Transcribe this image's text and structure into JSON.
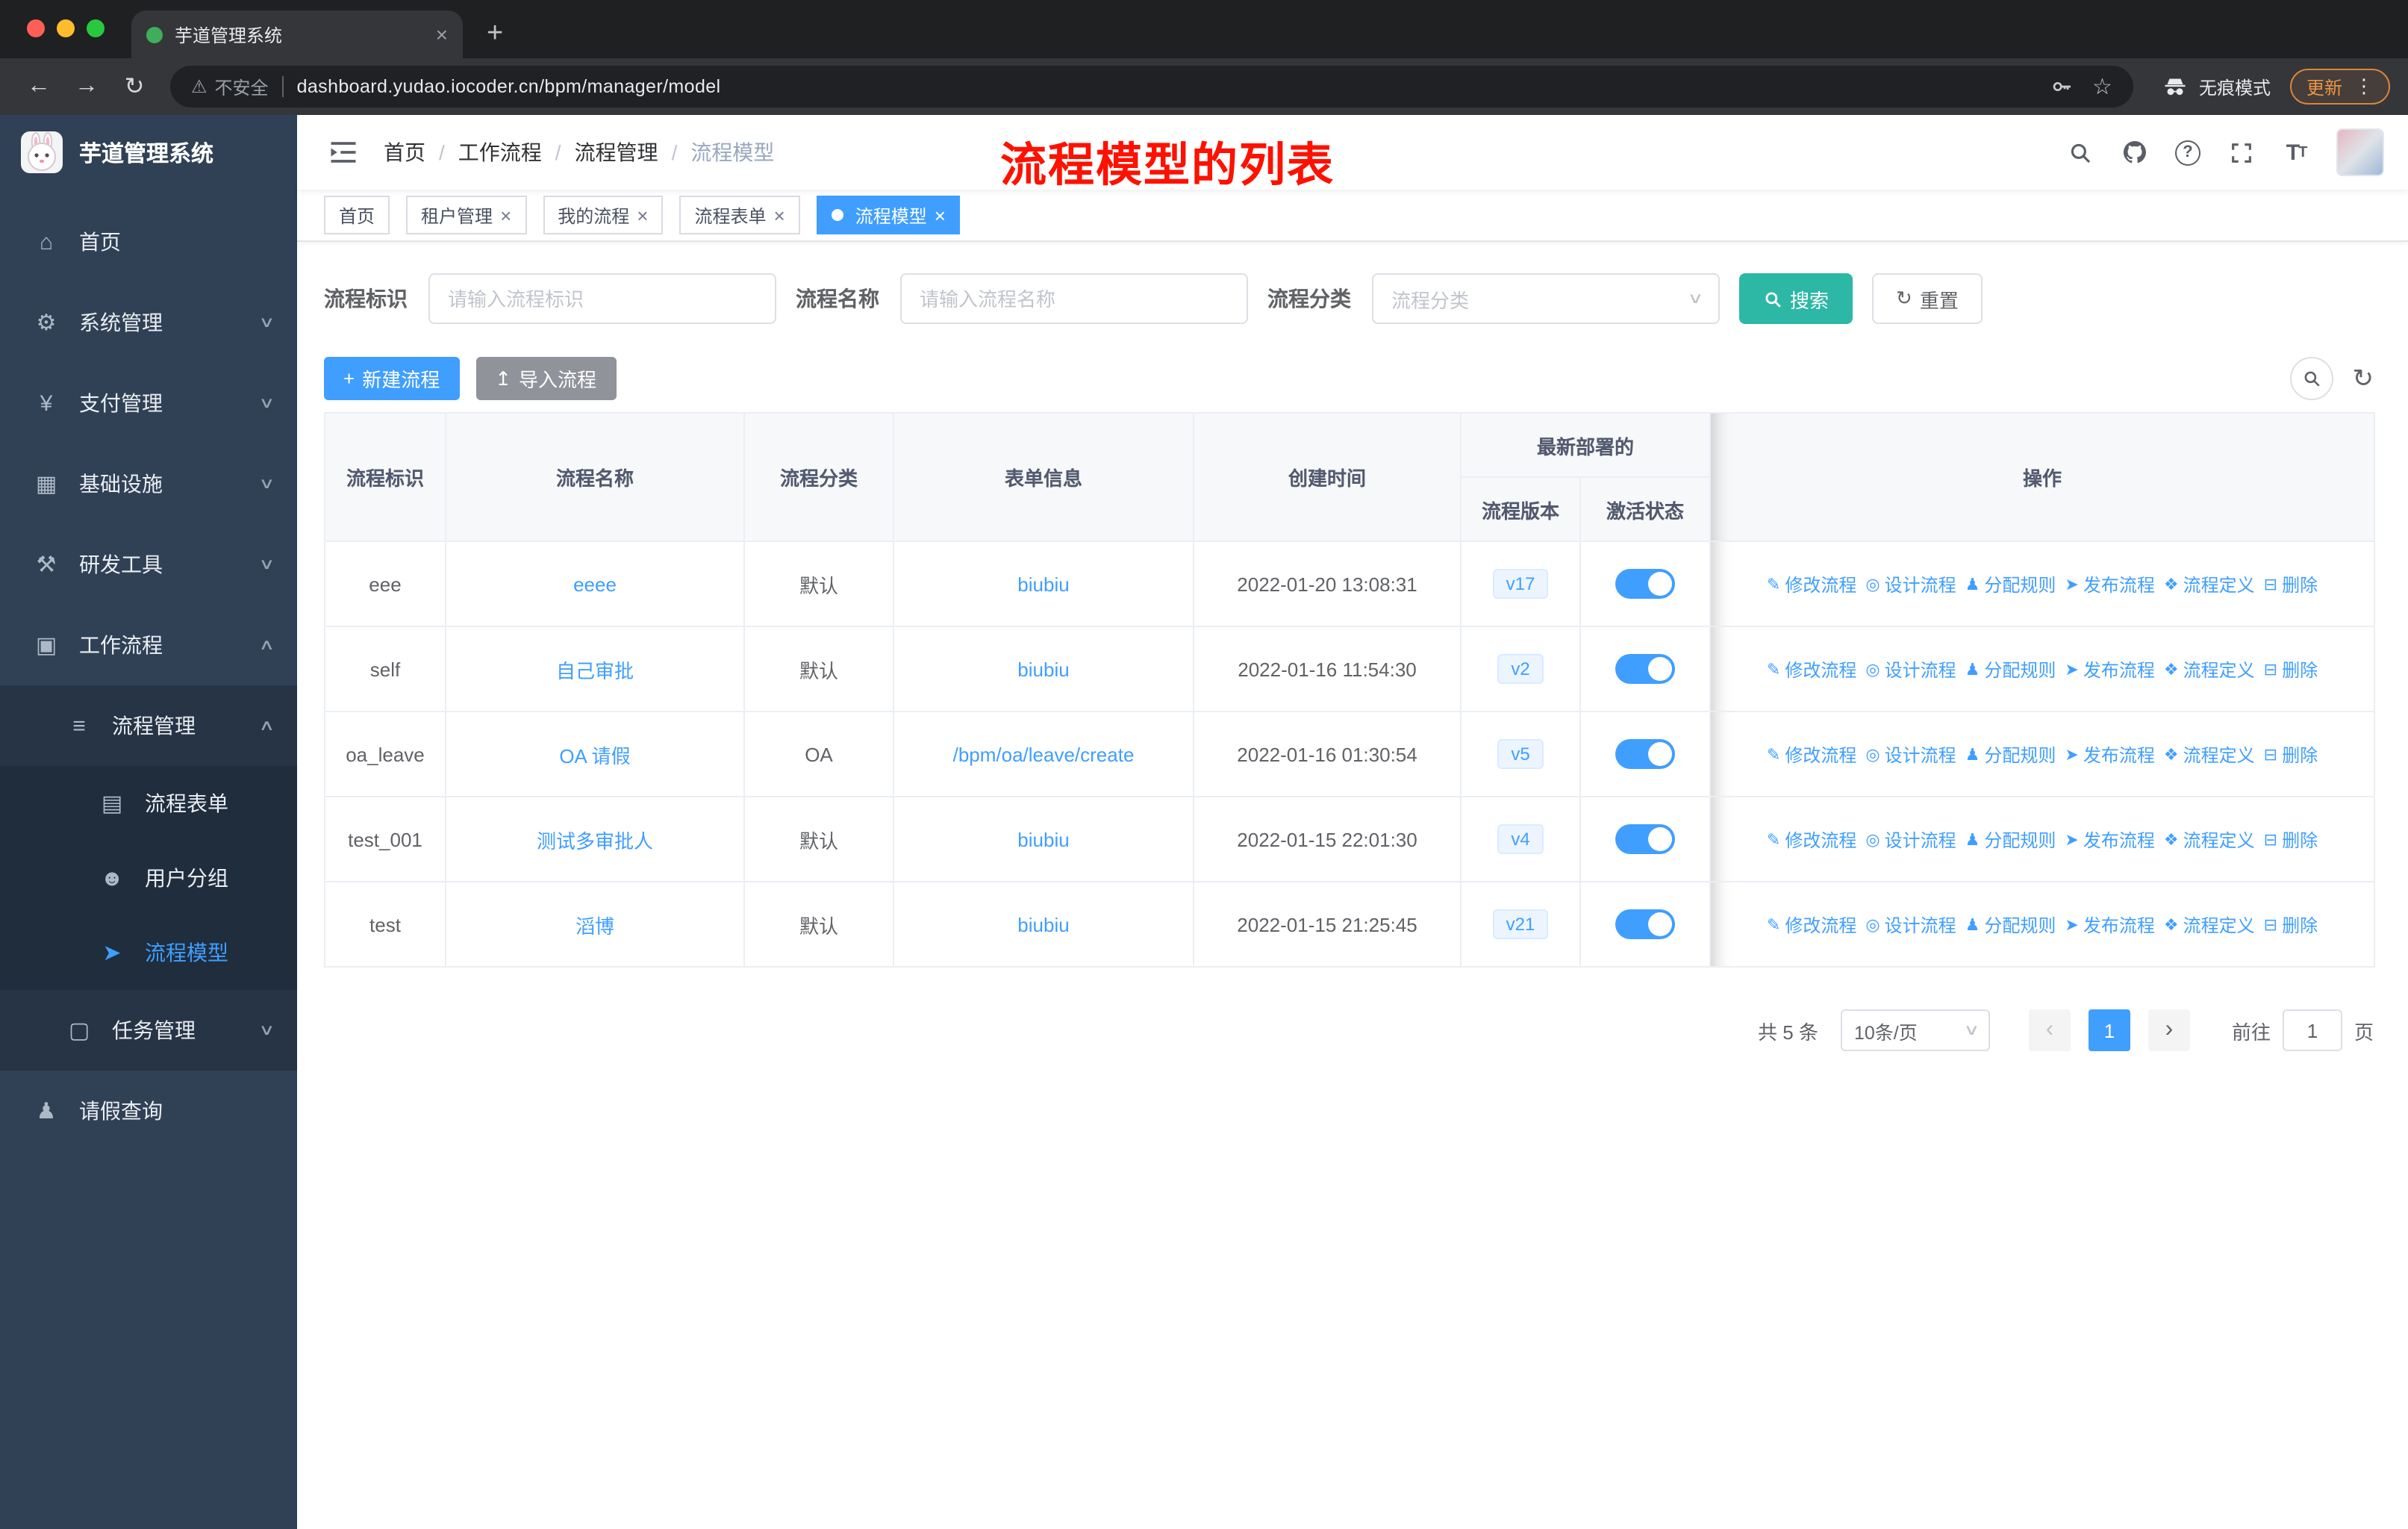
{
  "browser": {
    "tab": {
      "title": "芋道管理系统"
    },
    "address": {
      "security_label": "不安全",
      "url": "dashboard.yudao.iocoder.cn/bpm/manager/model"
    },
    "incognito_label": "无痕模式",
    "update_label": "更新"
  },
  "sidebar": {
    "logo_title": "芋道管理系统",
    "menu": [
      {
        "label": "首页",
        "icon": "home-icon",
        "level": 0,
        "arrow": null,
        "active": false
      },
      {
        "label": "系统管理",
        "icon": "gear-icon",
        "level": 0,
        "arrow": "down",
        "active": false
      },
      {
        "label": "支付管理",
        "icon": "yen-icon",
        "level": 0,
        "arrow": "down",
        "active": false
      },
      {
        "label": "基础设施",
        "icon": "infrastructure-icon",
        "level": 0,
        "arrow": "down",
        "active": false
      },
      {
        "label": "研发工具",
        "icon": "tools-icon",
        "level": 0,
        "arrow": "down",
        "active": false
      },
      {
        "label": "工作流程",
        "icon": "workflow-icon",
        "level": 0,
        "arrow": "up",
        "active": false
      },
      {
        "label": "流程管理",
        "icon": "process-manage-icon",
        "level": 1,
        "arrow": "up",
        "active": false
      },
      {
        "label": "流程表单",
        "icon": "form-icon",
        "level": 2,
        "arrow": null,
        "active": false
      },
      {
        "label": "用户分组",
        "icon": "user-group-icon",
        "level": 2,
        "arrow": null,
        "active": false
      },
      {
        "label": "流程模型",
        "icon": "model-icon",
        "level": 2,
        "arrow": null,
        "active": true
      },
      {
        "label": "任务管理",
        "icon": "task-icon",
        "level": 1,
        "arrow": "down",
        "active": false
      },
      {
        "label": "请假查询",
        "icon": "leave-icon",
        "level": 0,
        "arrow": null,
        "active": false
      }
    ]
  },
  "navbar": {
    "breadcrumb": [
      "首页",
      "工作流程",
      "流程管理",
      "流程模型"
    ],
    "annotation": "流程模型的列表"
  },
  "tags": [
    {
      "label": "首页",
      "closable": false,
      "active": false
    },
    {
      "label": "租户管理",
      "closable": true,
      "active": false
    },
    {
      "label": "我的流程",
      "closable": true,
      "active": false
    },
    {
      "label": "流程表单",
      "closable": true,
      "active": false
    },
    {
      "label": "流程模型",
      "closable": true,
      "active": true
    }
  ],
  "filters": {
    "key": {
      "label": "流程标识",
      "placeholder": "请输入流程标识",
      "value": ""
    },
    "name": {
      "label": "流程名称",
      "placeholder": "请输入流程名称",
      "value": ""
    },
    "category": {
      "label": "流程分类",
      "placeholder": "流程分类"
    },
    "search_label": "搜索",
    "reset_label": "重置"
  },
  "toolbar": {
    "create_label": "新建流程",
    "import_label": "导入流程"
  },
  "table": {
    "headers": {
      "key": "流程标识",
      "name": "流程名称",
      "category": "流程分类",
      "form": "表单信息",
      "created": "创建时间",
      "deploy_group": "最新部署的",
      "version": "流程版本",
      "active": "激活状态",
      "actions": "操作"
    },
    "actions": [
      {
        "label": "修改流程",
        "icon": "edit-icon"
      },
      {
        "label": "设计流程",
        "icon": "design-icon"
      },
      {
        "label": "分配规则",
        "icon": "assign-icon"
      },
      {
        "label": "发布流程",
        "icon": "publish-icon"
      },
      {
        "label": "流程定义",
        "icon": "definition-icon"
      },
      {
        "label": "删除",
        "icon": "delete-icon"
      }
    ],
    "rows": [
      {
        "key": "eee",
        "name": "eeee",
        "category": "默认",
        "form": "biubiu",
        "created": "2022-01-20 13:08:31",
        "version": "v17",
        "active": true
      },
      {
        "key": "self",
        "name": "自己审批",
        "category": "默认",
        "form": "biubiu",
        "created": "2022-01-16 11:54:30",
        "version": "v2",
        "active": true
      },
      {
        "key": "oa_leave",
        "name": "OA 请假",
        "category": "OA",
        "form": "/bpm/oa/leave/create",
        "created": "2022-01-16 01:30:54",
        "version": "v5",
        "active": true
      },
      {
        "key": "test_001",
        "name": "测试多审批人",
        "category": "默认",
        "form": "biubiu",
        "created": "2022-01-15 22:01:30",
        "version": "v4",
        "active": true
      },
      {
        "key": "test",
        "name": "滔博",
        "category": "默认",
        "form": "biubiu",
        "created": "2022-01-15 21:25:45",
        "version": "v21",
        "active": true
      }
    ]
  },
  "pagination": {
    "total_label": "共 5 条",
    "page_size": "10条/页",
    "current_page": "1",
    "goto_label": "前往",
    "goto_value": "1",
    "page_label": "页"
  },
  "colors": {
    "primary": "#409eff",
    "search_button": "#2db7a5",
    "info_button": "#909399",
    "sidebar_bg": "#304156",
    "submenu_bg": "#1f2d3d",
    "annotation_red": "#fe1100",
    "tag_active": "#409eff"
  }
}
